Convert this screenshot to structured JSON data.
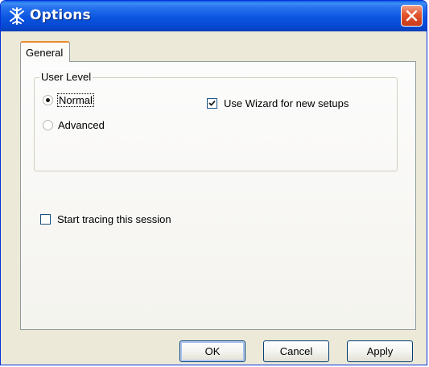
{
  "window": {
    "title": "Options"
  },
  "tabs": [
    {
      "label": "General",
      "selected": true
    }
  ],
  "user_level": {
    "group_label": "User Level",
    "options": [
      {
        "label": "Normal",
        "selected": true
      },
      {
        "label": "Advanced",
        "selected": false
      }
    ]
  },
  "wizard_checkbox": {
    "label": "Use Wizard for new setups",
    "checked": true
  },
  "tracing_checkbox": {
    "label": "Start tracing this session",
    "checked": false
  },
  "buttons": {
    "ok": "OK",
    "cancel": "Cancel",
    "apply": "Apply"
  },
  "icons": {
    "app": "gear-sparkle-icon",
    "close": "close-icon"
  },
  "colors": {
    "titlebar": "#0a55e0",
    "close_button": "#e2552c",
    "window_face": "#ece9d8",
    "tab_highlight": "#e68b2c"
  }
}
